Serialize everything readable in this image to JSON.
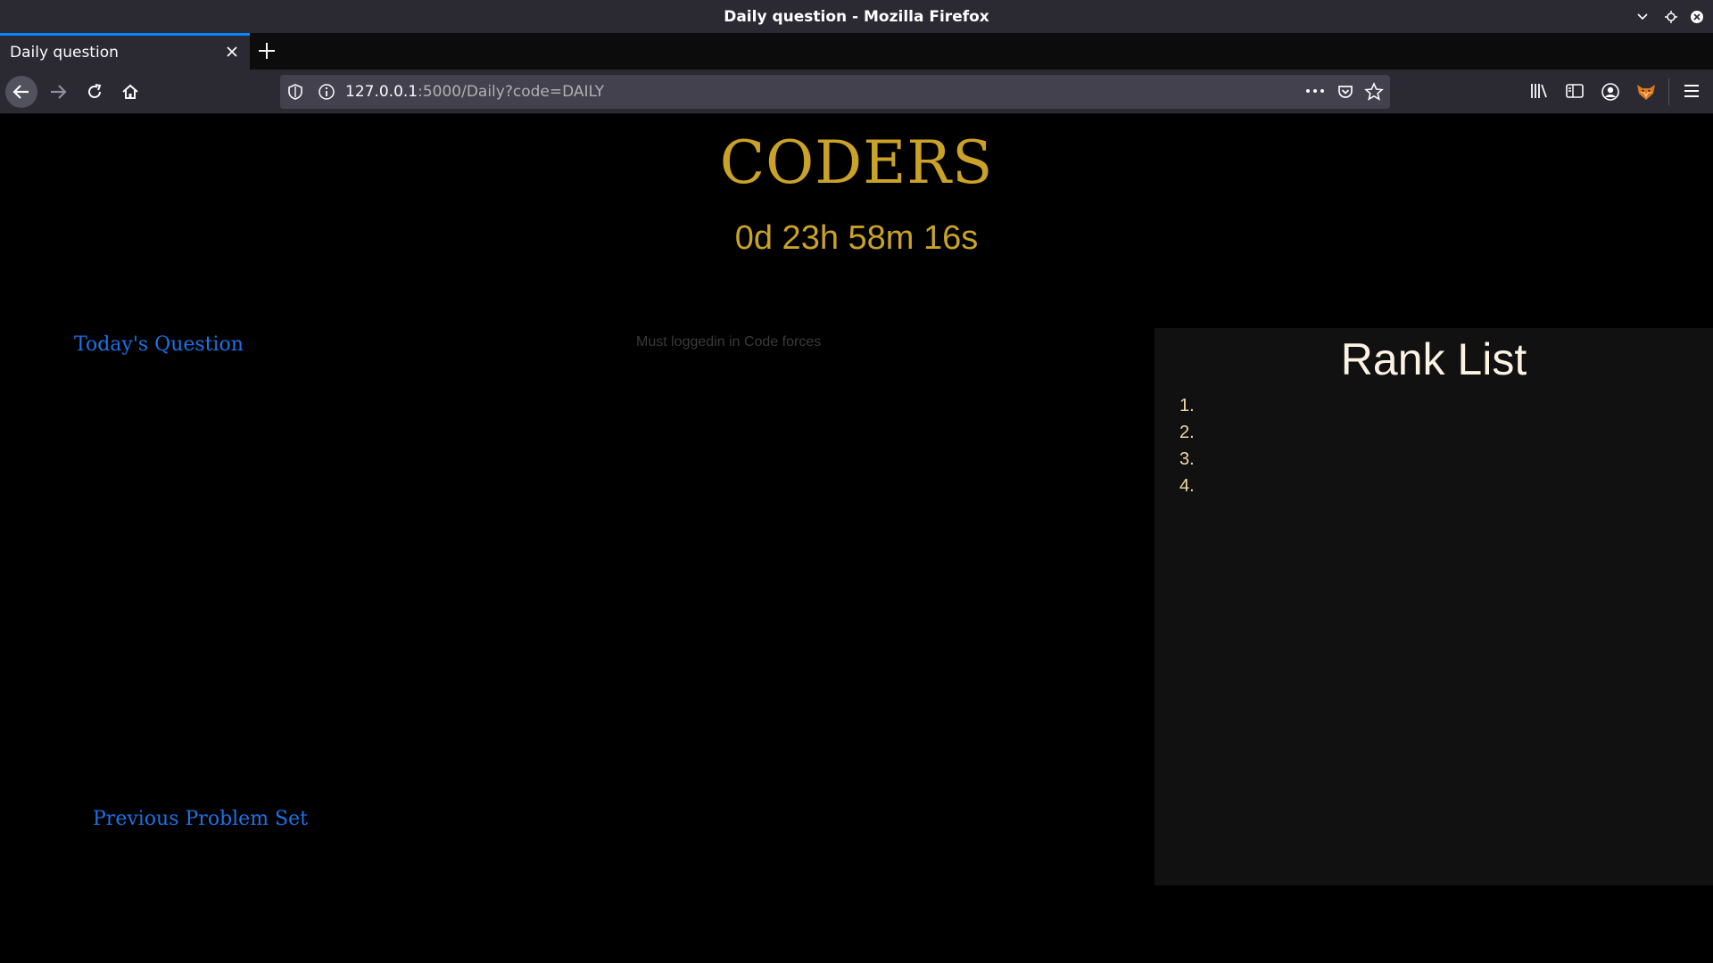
{
  "window": {
    "title": "Daily question - Mozilla Firefox"
  },
  "tabs": [
    {
      "label": "Daily question"
    }
  ],
  "urlbar": {
    "host": "127.0.0.1",
    "rest": ":5000/Daily?code=DAILY"
  },
  "icons": {
    "back": "back-arrow-icon",
    "forward": "forward-arrow-icon",
    "reload": "reload-icon",
    "home": "home-icon",
    "shield": "shield-icon",
    "info": "info-icon",
    "more": "more-dots-icon",
    "pocket": "pocket-icon",
    "bookmark": "star-icon",
    "library": "library-icon",
    "sidebar": "sidebar-icon",
    "account": "account-icon",
    "extension": "fox-extension-icon",
    "menu": "hamburger-menu-icon"
  },
  "page": {
    "brand": "CODERS",
    "countdown": "0d 23h 58m 16s",
    "todays_question_link": "Today's Question",
    "login_note": "Must loggedin in Code forces",
    "previous_problem_set_link": "Previous Problem Set",
    "rank_list": {
      "title": "Rank List",
      "items": [
        "1.",
        "2.",
        "3.",
        "4."
      ]
    }
  },
  "colors": {
    "accent_gold": "#c9a227",
    "link_blue": "#1a73e8",
    "rank_item": "#f4d9a8",
    "tab_highlight": "#0a84ff"
  }
}
